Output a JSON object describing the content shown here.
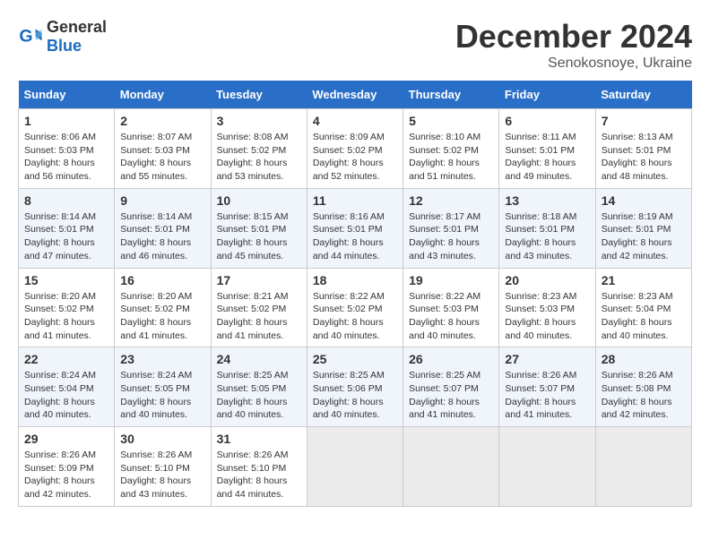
{
  "header": {
    "logo_general": "General",
    "logo_blue": "Blue",
    "month_title": "December 2024",
    "subtitle": "Senokosnoye, Ukraine"
  },
  "days_of_week": [
    "Sunday",
    "Monday",
    "Tuesday",
    "Wednesday",
    "Thursday",
    "Friday",
    "Saturday"
  ],
  "weeks": [
    [
      {
        "day": "1",
        "sunrise": "8:06 AM",
        "sunset": "5:03 PM",
        "daylight": "8 hours and 56 minutes."
      },
      {
        "day": "2",
        "sunrise": "8:07 AM",
        "sunset": "5:03 PM",
        "daylight": "8 hours and 55 minutes."
      },
      {
        "day": "3",
        "sunrise": "8:08 AM",
        "sunset": "5:02 PM",
        "daylight": "8 hours and 53 minutes."
      },
      {
        "day": "4",
        "sunrise": "8:09 AM",
        "sunset": "5:02 PM",
        "daylight": "8 hours and 52 minutes."
      },
      {
        "day": "5",
        "sunrise": "8:10 AM",
        "sunset": "5:02 PM",
        "daylight": "8 hours and 51 minutes."
      },
      {
        "day": "6",
        "sunrise": "8:11 AM",
        "sunset": "5:01 PM",
        "daylight": "8 hours and 49 minutes."
      },
      {
        "day": "7",
        "sunrise": "8:13 AM",
        "sunset": "5:01 PM",
        "daylight": "8 hours and 48 minutes."
      }
    ],
    [
      {
        "day": "8",
        "sunrise": "8:14 AM",
        "sunset": "5:01 PM",
        "daylight": "8 hours and 47 minutes."
      },
      {
        "day": "9",
        "sunrise": "8:14 AM",
        "sunset": "5:01 PM",
        "daylight": "8 hours and 46 minutes."
      },
      {
        "day": "10",
        "sunrise": "8:15 AM",
        "sunset": "5:01 PM",
        "daylight": "8 hours and 45 minutes."
      },
      {
        "day": "11",
        "sunrise": "8:16 AM",
        "sunset": "5:01 PM",
        "daylight": "8 hours and 44 minutes."
      },
      {
        "day": "12",
        "sunrise": "8:17 AM",
        "sunset": "5:01 PM",
        "daylight": "8 hours and 43 minutes."
      },
      {
        "day": "13",
        "sunrise": "8:18 AM",
        "sunset": "5:01 PM",
        "daylight": "8 hours and 43 minutes."
      },
      {
        "day": "14",
        "sunrise": "8:19 AM",
        "sunset": "5:01 PM",
        "daylight": "8 hours and 42 minutes."
      }
    ],
    [
      {
        "day": "15",
        "sunrise": "8:20 AM",
        "sunset": "5:02 PM",
        "daylight": "8 hours and 41 minutes."
      },
      {
        "day": "16",
        "sunrise": "8:20 AM",
        "sunset": "5:02 PM",
        "daylight": "8 hours and 41 minutes."
      },
      {
        "day": "17",
        "sunrise": "8:21 AM",
        "sunset": "5:02 PM",
        "daylight": "8 hours and 41 minutes."
      },
      {
        "day": "18",
        "sunrise": "8:22 AM",
        "sunset": "5:02 PM",
        "daylight": "8 hours and 40 minutes."
      },
      {
        "day": "19",
        "sunrise": "8:22 AM",
        "sunset": "5:03 PM",
        "daylight": "8 hours and 40 minutes."
      },
      {
        "day": "20",
        "sunrise": "8:23 AM",
        "sunset": "5:03 PM",
        "daylight": "8 hours and 40 minutes."
      },
      {
        "day": "21",
        "sunrise": "8:23 AM",
        "sunset": "5:04 PM",
        "daylight": "8 hours and 40 minutes."
      }
    ],
    [
      {
        "day": "22",
        "sunrise": "8:24 AM",
        "sunset": "5:04 PM",
        "daylight": "8 hours and 40 minutes."
      },
      {
        "day": "23",
        "sunrise": "8:24 AM",
        "sunset": "5:05 PM",
        "daylight": "8 hours and 40 minutes."
      },
      {
        "day": "24",
        "sunrise": "8:25 AM",
        "sunset": "5:05 PM",
        "daylight": "8 hours and 40 minutes."
      },
      {
        "day": "25",
        "sunrise": "8:25 AM",
        "sunset": "5:06 PM",
        "daylight": "8 hours and 40 minutes."
      },
      {
        "day": "26",
        "sunrise": "8:25 AM",
        "sunset": "5:07 PM",
        "daylight": "8 hours and 41 minutes."
      },
      {
        "day": "27",
        "sunrise": "8:26 AM",
        "sunset": "5:07 PM",
        "daylight": "8 hours and 41 minutes."
      },
      {
        "day": "28",
        "sunrise": "8:26 AM",
        "sunset": "5:08 PM",
        "daylight": "8 hours and 42 minutes."
      }
    ],
    [
      {
        "day": "29",
        "sunrise": "8:26 AM",
        "sunset": "5:09 PM",
        "daylight": "8 hours and 42 minutes."
      },
      {
        "day": "30",
        "sunrise": "8:26 AM",
        "sunset": "5:10 PM",
        "daylight": "8 hours and 43 minutes."
      },
      {
        "day": "31",
        "sunrise": "8:26 AM",
        "sunset": "5:10 PM",
        "daylight": "8 hours and 44 minutes."
      },
      null,
      null,
      null,
      null
    ]
  ]
}
